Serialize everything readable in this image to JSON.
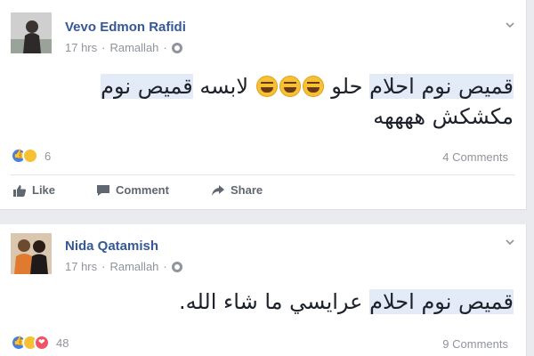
{
  "posts": [
    {
      "author": "Vevo Edmon Rafidi",
      "time": "17 hrs",
      "location": "Ramallah",
      "text_parts": [
        "قميص نوم احلام",
        "حلو",
        "لابسه",
        "قميص نوم",
        "مكشكش",
        "ههههه"
      ],
      "reaction_count": "6",
      "comments": "4 Comments",
      "actions": {
        "like": "Like",
        "comment": "Comment",
        "share": "Share"
      }
    },
    {
      "author": "Nida Qatamish",
      "time": "17 hrs",
      "location": "Ramallah",
      "text_parts": [
        "قميص نوم احلام",
        "عرايسي ما شاء الله."
      ],
      "reaction_count": "48",
      "comments": "9 Comments"
    }
  ],
  "colors": {
    "author": "#365899",
    "meta": "#90949c",
    "highlight": "#e3ebf8",
    "background": "#e9ebee"
  },
  "icons": [
    "globe-icon",
    "chevron-down-icon",
    "like-icon",
    "comment-icon",
    "share-icon",
    "like-reaction-icon",
    "haha-reaction-icon",
    "love-reaction-icon",
    "laughing-emoji-icon"
  ]
}
